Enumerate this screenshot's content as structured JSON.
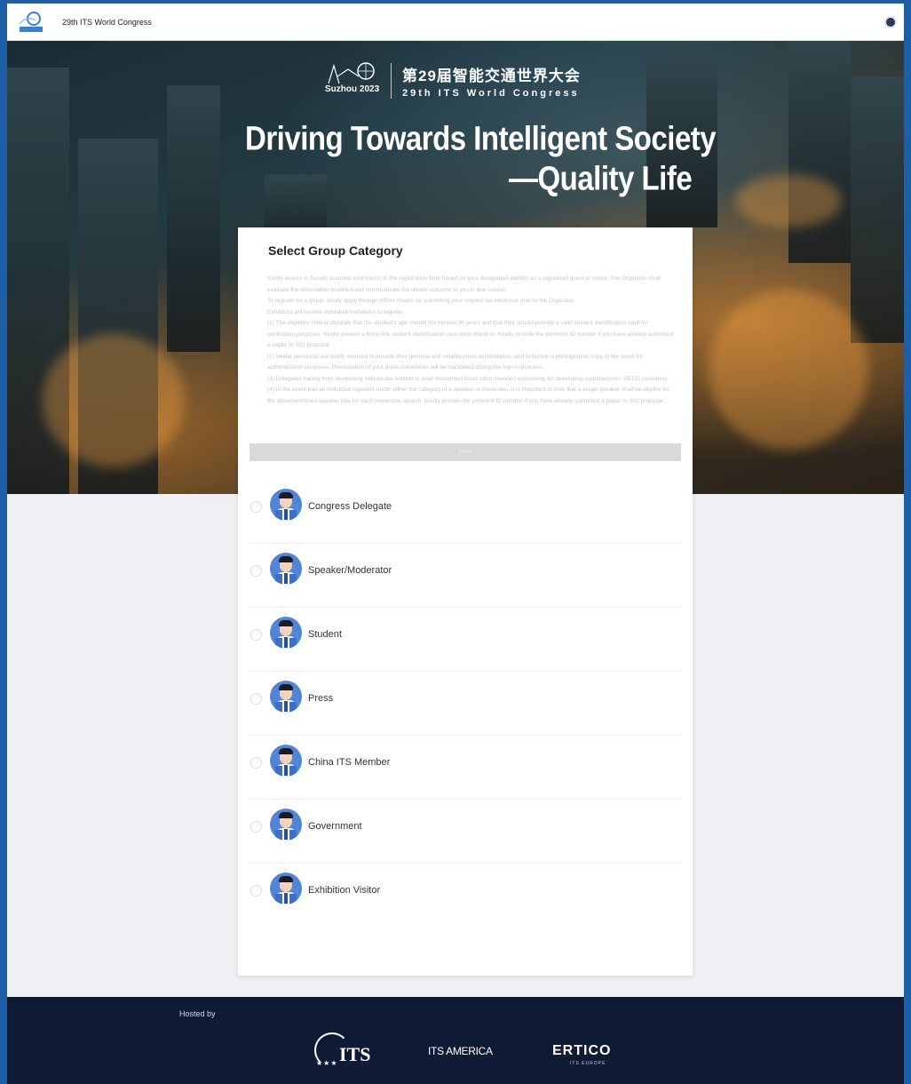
{
  "topbar": {
    "logo_alt": "Suzhou 2023",
    "site_title": "29th ITS World Congress"
  },
  "hero": {
    "brand_cn": "第29届智能交通世界大会",
    "brand_en": "29th ITS World Congress",
    "brand_year": "Suzhou 2023",
    "slogan_line1": "Driving Towards Intelligent Society",
    "slogan_line2": "—Quality Life"
  },
  "card": {
    "title": "Select Group Category",
    "notice": [
      "Kindly ensure to furnish accurate information in the registration form based on your designated identity as a registered guest or visitor. The Organizer shall evaluate the information provided and communicate the review outcome to you in due course.",
      "To register for a group, kindly apply through offline means by submitting your request via electronic mail to the Organizer.",
      "Exhibitors will receive individual invitations to register.",
      "(1) The eligibility criteria stipulate that the student's age should not exceed 30 years and that they should provide a valid student identification card for verification purposes. Kindly present a bona fide student identification card upon check-in. Kindly provide the pertinent ID number if you have already submitted a paper or SIG proposal.",
      "(2) Media personnel are kindly required to provide their genuine and reliable press accreditation, and to furnish a photographic copy of the same for authentication purposes. Presentation of your press credentials will be mandated during the sign-in process.",
      "(3) Delegates hailing from developing nations are entitled to avail discounted ticket rates intended exclusively for developing countries(non- OECD countries).",
      "(4) In the event that an individual registers under either the category of a speaker or moderator, it is important to note that a single speaker shall be eligible for the aforementioned speaker rate for each respective speech. Kindly provide the pertinent ID number if you have already submitted a paper or SIG proposal."
    ],
    "accept_label": "Next"
  },
  "options": [
    {
      "label": "Congress Delegate"
    },
    {
      "label": "Speaker/Moderator"
    },
    {
      "label": "Student"
    },
    {
      "label": "Press"
    },
    {
      "label": "China ITS Member"
    },
    {
      "label": "Government"
    },
    {
      "label": "Exhibition Visitor"
    }
  ],
  "footer": {
    "hosted_by": "Hosted by",
    "logo_its": "ITS",
    "logo_america": "ITS AMERICA",
    "logo_ertico": "ERTICO",
    "logo_ertico_sub": "ITS EUROPE"
  },
  "colors": {
    "accent": "#4f86d8",
    "footer_bg": "#0f1b35",
    "page_bg": "#eef0f3"
  }
}
